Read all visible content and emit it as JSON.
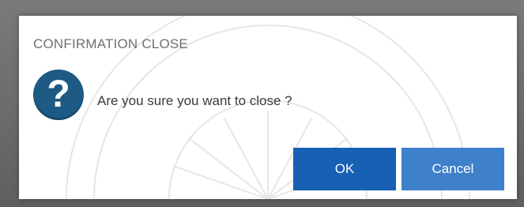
{
  "dialog": {
    "title": "CONFIRMATION CLOSE",
    "icon": "question-mark-icon",
    "message": "Are you sure you want to close ?",
    "ok_label": "OK",
    "cancel_label": "Cancel"
  },
  "colors": {
    "icon_bg": "#1d5a84",
    "ok_bg": "#1760b3",
    "cancel_bg": "#3e80c9",
    "title_text": "#6f6f6f",
    "message_text": "#3a3a3a"
  }
}
